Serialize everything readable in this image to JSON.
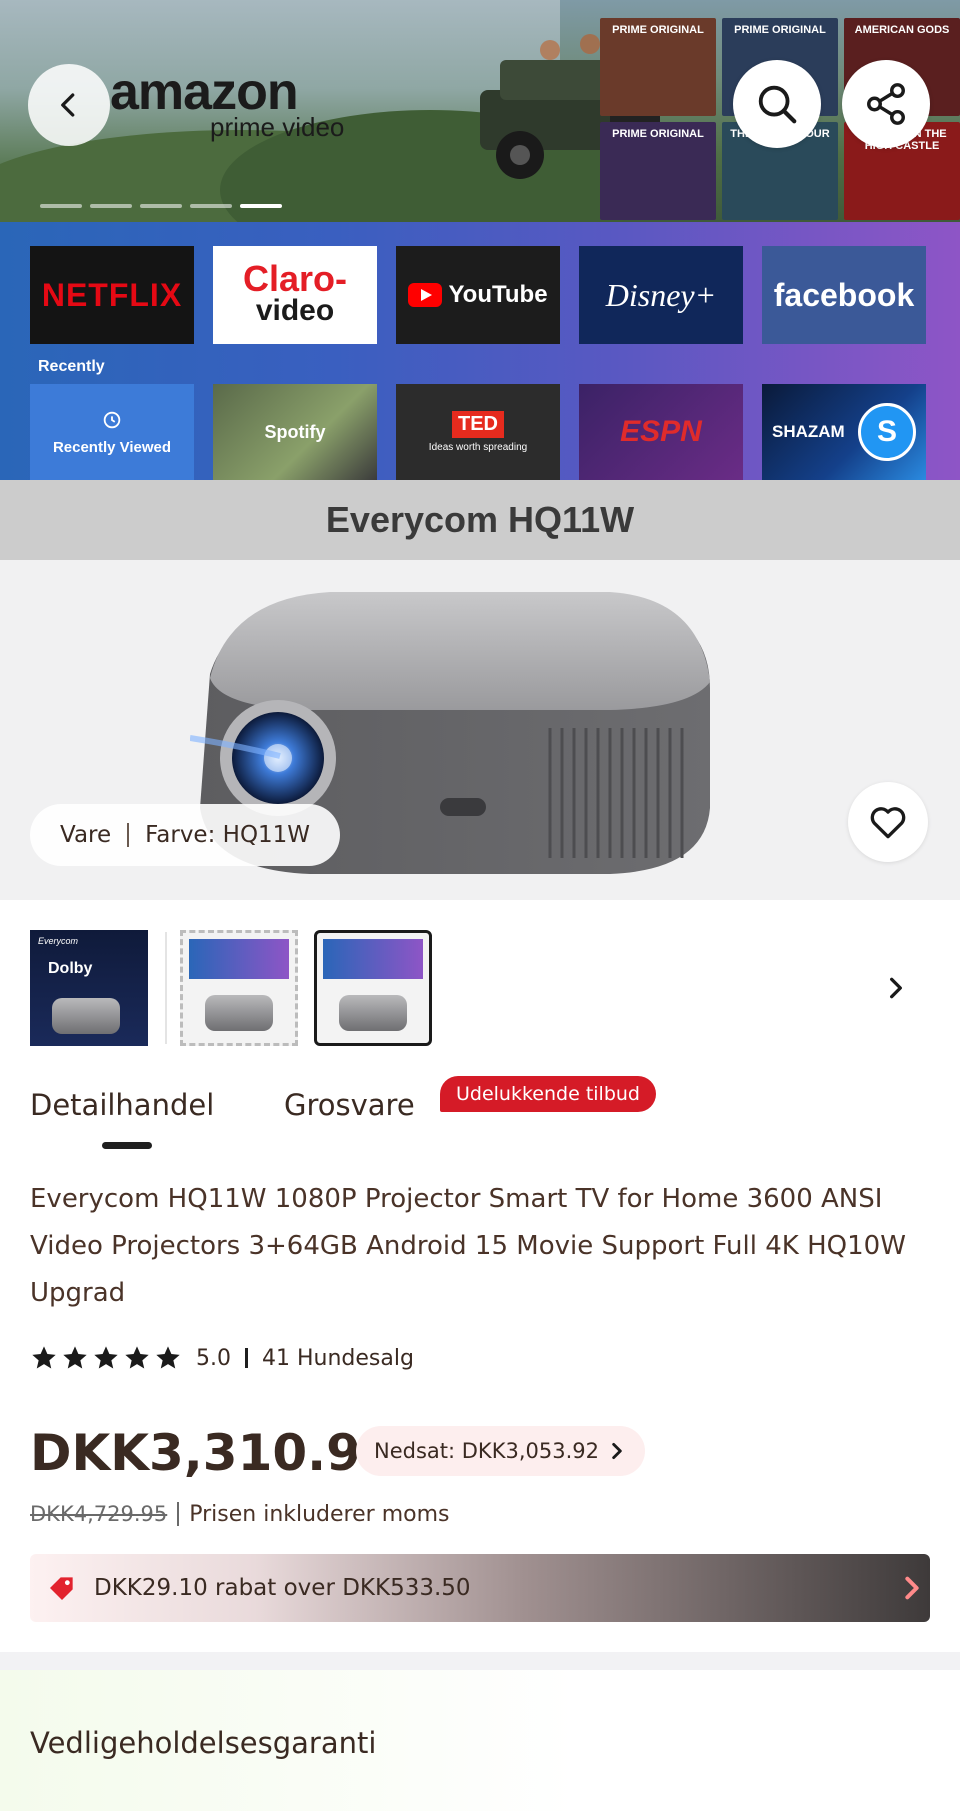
{
  "banner": {
    "logo_word": "amazon",
    "logo_sub": "prime video",
    "posters": [
      {
        "label": "PRIME ORIGINAL",
        "color": "#6a3a2a"
      },
      {
        "label": "PRIME ORIGINAL",
        "color": "#2b3d5a"
      },
      {
        "label": "AMERICAN GODS",
        "color": "#5a1f1f"
      },
      {
        "label": "PRIME ORIGINAL",
        "color": "#3a2a55"
      },
      {
        "label": "THE GRAND TOUR",
        "color": "#2a4a5a"
      },
      {
        "label": "THE MAN IN THE HIGH CASTLE",
        "color": "#8a1a1a"
      }
    ],
    "carousel_count": 5,
    "carousel_active_index": 5
  },
  "apps": {
    "row1": [
      "NETFLIX",
      "Claro-",
      "video",
      "YouTube",
      "Disney+",
      "facebook"
    ],
    "recently_label": "Recently",
    "row2": [
      "Recently Viewed",
      "Spotify",
      "TED",
      "Ideas worth spreading",
      "ESPN",
      "SHAZAM"
    ]
  },
  "product_band": {
    "title": "Everycom HQ11W"
  },
  "variant": {
    "label": "Vare",
    "color": "Farve: HQ11W"
  },
  "thumbs": {
    "thumb1_brand": "Everycom",
    "thumb1_dolby": "Dolby"
  },
  "tabs": [
    {
      "label": "Detailhandel",
      "active": true
    },
    {
      "label": "Grosvare",
      "active": false
    }
  ],
  "offer_badge": "Udelukkende tilbud",
  "product": {
    "title": "Everycom HQ11W 1080P Projector Smart TV for Home 3600 ANSI Video Projectors 3+64GB Android 15 Movie Support Full 4K HQ10W Upgrad",
    "rating": "5.0",
    "rating_value": 5.0,
    "rating_max": 5,
    "sold": "41 Hundesalg",
    "price": "DKK3,310.97",
    "discount": "Nedsat: DKK3,053.92",
    "old_price": "DKK4,729.95",
    "vat_note": "Prisen inkluderer moms",
    "coupon": "DKK29.10 rabat over DKK533.50"
  },
  "warranty": {
    "title": "Vedligeholdelsesgaranti"
  },
  "colors": {
    "accent_red": "#d51b27",
    "text_brown": "#3a2a22",
    "product_band": "#cccccc"
  }
}
